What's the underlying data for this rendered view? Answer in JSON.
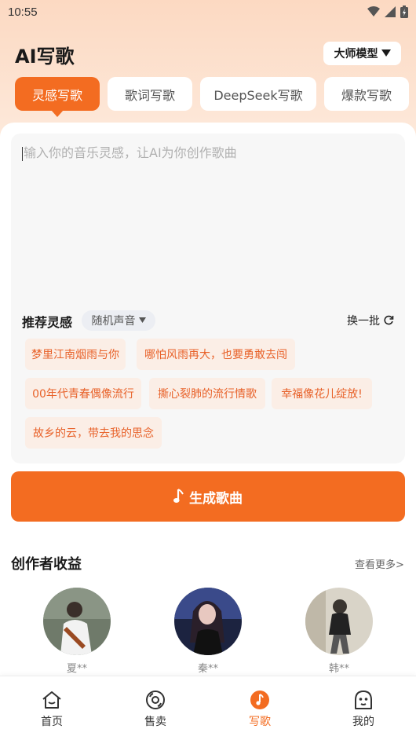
{
  "status_bar": {
    "time": "10:55"
  },
  "header": {
    "title": "AI写歌",
    "model_label": "大师模型"
  },
  "tabs": [
    {
      "label": "灵感写歌",
      "active": true
    },
    {
      "label": "歌词写歌",
      "active": false
    },
    {
      "label": "DeepSeek写歌",
      "active": false
    },
    {
      "label": "爆款写歌",
      "active": false
    }
  ],
  "input": {
    "placeholder": "输入你的音乐灵感，让AI为你创作歌曲"
  },
  "recommend": {
    "title": "推荐灵感",
    "voice_label": "随机声音",
    "refresh_label": "换一批",
    "chips": [
      "梦里江南烟雨与你",
      "哪怕风雨再大，也要勇敢去闯",
      "00年代青春偶像流行",
      "撕心裂肺的流行情歌",
      "幸福像花儿绽放!",
      "故乡的云，带去我的思念"
    ]
  },
  "generate_button": {
    "label": "生成歌曲"
  },
  "creators": {
    "title": "创作者收益",
    "more_label": "查看更多>",
    "items": [
      {
        "name": "夏**"
      },
      {
        "name": "秦**"
      },
      {
        "name": "韩**"
      }
    ]
  },
  "bottom_nav": [
    {
      "label": "首页",
      "icon": "home-icon",
      "active": false
    },
    {
      "label": "售卖",
      "icon": "vinyl-icon",
      "active": false
    },
    {
      "label": "写歌",
      "icon": "music-note-icon",
      "active": true
    },
    {
      "label": "我的",
      "icon": "profile-icon",
      "active": false
    }
  ],
  "colors": {
    "accent": "#f36c21",
    "chip_bg": "#fbeee6",
    "chip_text": "#e8622a"
  }
}
